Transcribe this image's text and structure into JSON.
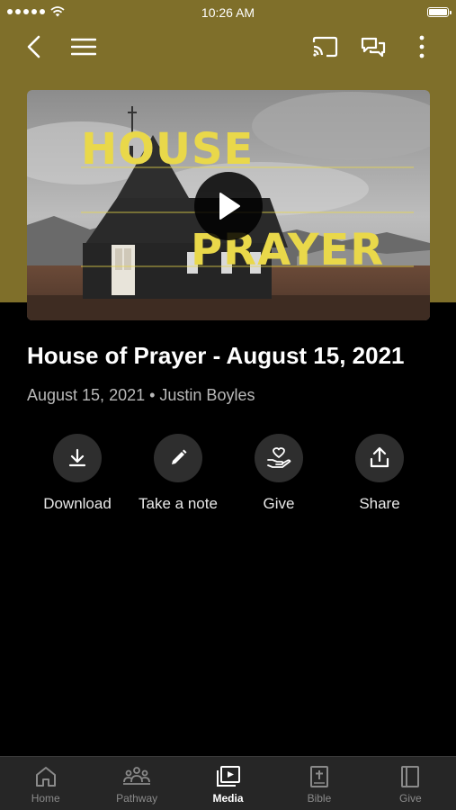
{
  "status_bar": {
    "time": "10:26 AM"
  },
  "colors": {
    "header_bg": "#7f6f2a",
    "thumb_text": "#e9d84a",
    "background": "#000000",
    "tabbar_bg": "#262626"
  },
  "top_nav": {
    "icons": [
      "back-icon",
      "menu-icon",
      "cast-icon",
      "chat-icon",
      "more-icon"
    ]
  },
  "thumbnail": {
    "line1": "HOUSE",
    "line2": "PRAYER",
    "icon": "play-icon"
  },
  "sermon": {
    "title": "House of Prayer - August 15, 2021",
    "meta": "August 15, 2021 • Justin Boyles"
  },
  "actions": [
    {
      "label": "Download",
      "icon": "download-icon"
    },
    {
      "label": "Take a note",
      "icon": "pencil-icon"
    },
    {
      "label": "Give",
      "icon": "give-hand-heart-icon"
    },
    {
      "label": "Share",
      "icon": "share-icon"
    }
  ],
  "tabs": [
    {
      "label": "Home",
      "icon": "home-icon",
      "active": false
    },
    {
      "label": "Pathway",
      "icon": "people-icon",
      "active": false
    },
    {
      "label": "Media",
      "icon": "media-icon",
      "active": true
    },
    {
      "label": "Bible",
      "icon": "bible-icon",
      "active": false
    },
    {
      "label": "Give",
      "icon": "book-icon",
      "active": false
    }
  ]
}
